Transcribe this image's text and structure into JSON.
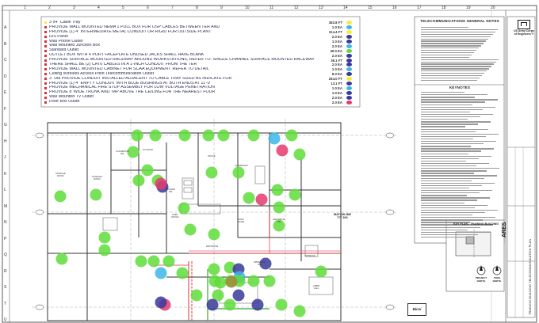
{
  "sheet": {
    "columns": [
      "1",
      "2",
      "3",
      "4",
      "5",
      "6",
      "7",
      "8",
      "9",
      "10",
      "11",
      "12",
      "13",
      "14",
      "15",
      "16",
      "17",
      "18",
      "19",
      "20"
    ],
    "rows": [
      "A",
      "B",
      "C",
      "D",
      "E",
      "F",
      "G",
      "H",
      "J",
      "K",
      "L",
      "M",
      "N",
      "P",
      "Q",
      "R",
      "S",
      "T",
      "U"
    ]
  },
  "legend": [
    {
      "text": "3\"x4\" Cable Tray",
      "qty": "382.8 FT",
      "swatch": "#f5ed3d",
      "marker": "#f5ed3d"
    },
    {
      "text": "PROVIDE WALL MOUNTED NEMA 1 PULL BOX FOR OSP CABLES BETWEEN TER AND",
      "qty": "1.0 EA",
      "swatch": "#3bb7e8",
      "marker": "#d33"
    },
    {
      "text": "PROVIDE (1) 4\" INTERMEDIATE METAL CONDUIT OR RIGID FOR OUTSIDE PLANT",
      "qty": "314.4 FT",
      "swatch": "#f5ed3d",
      "marker": "#d33"
    },
    {
      "text": "IDS Panel",
      "qty": "2.0 EA",
      "swatch": "#3a3a9a",
      "marker": "#d33"
    },
    {
      "text": "Wall Phone Outlet",
      "qty": "1.0 EA",
      "swatch": "#3a3a9a",
      "marker": "#d33"
    },
    {
      "text": "Wall Mounted Junction Box",
      "qty": "2.0 EA",
      "swatch": "#3bb7e8",
      "marker": "#d33"
    },
    {
      "text": "Standard Outlet",
      "qty": "49.0 EA",
      "swatch": "#5fdc3a",
      "marker": "#d33"
    },
    {
      "text": "OUTLET BOX WITH 4 PORT FACEPLATE UNUSED JACKS SHALL HAVE BLANK",
      "qty": "2.0 EA",
      "swatch": "#3a3a9a",
      "marker": "#d33"
    },
    {
      "text": "PROVIDE SURFACE MOUNTED RACEWAY AROUND WORKSTATIONS, REFER TO. SINGLE CHANNEL SURFACE MOUNTED RACEWAY",
      "qty": "36.1 FT",
      "swatch": "#3a3a9a",
      "marker": "#d33"
    },
    {
      "text": "THERE SHALL BE (2) CAT6 CABLES IN A 1-INCH CONDUIT FROM THE TER",
      "qty": "2.0 EA",
      "swatch": "#3a3a9a",
      "marker": "#d33"
    },
    {
      "text": "PROVIDE WALL MOUNTED CABINET FOR SCAA EQUIPMENT. REFER TO DETAIL",
      "qty": "1.0 EA",
      "swatch": "#3bb7e8",
      "marker": "#d33"
    },
    {
      "text": "Ceiling Wireless Access Point Telecommunication Outlet",
      "qty": "8.0 EA",
      "swatch": "#3a3a9a",
      "marker": "#d33"
    },
    {
      "text": "3\" Dia PROVIDE CONDUIT INSTALLED ADJACENT TO CABLE TRAY SIZED AS INDICATE FOR",
      "qty": "264.0 FT",
      "swatch": "#f5ed3d",
      "marker": "#d33"
    },
    {
      "text": "PROVIDE (1) 4\" EMPTY CONDUIT WITH BLUE BUSHINGS AT BOTH ENDS AT 11'-0\"",
      "qty": "13.1 FT",
      "swatch": "#3a3a9a",
      "marker": "#d33"
    },
    {
      "text": "PROVIDE MECHANICAL FIRE STOP ASSEMBLY FOR LOW VOLTAGE PENETRATION",
      "qty": "1.0 EA",
      "swatch": "#3bb7e8",
      "marker": "#d33"
    },
    {
      "text": "PROVIDE 8' WIDE TRUNK AND TAP ABOVE THE CEILING FOR THE NEAREST FOUR",
      "qty": "1.0 EA",
      "swatch": "#3a3a9a",
      "marker": "#d33"
    },
    {
      "text": "Wall Mounted TV Outlet",
      "qty": "2.0 EA",
      "swatch": "#3a3a9a",
      "marker": "#d33"
    },
    {
      "text": "Floor Box Outlet",
      "qty": "2.0 EA",
      "swatch": "#e53a6e",
      "marker": "#d33"
    }
  ],
  "notes": {
    "general_title": "TELECOMMUNICATIONS GENERAL NOTES",
    "keynotes_title": "KEYNOTES"
  },
  "title_block": {
    "org_line1": "US Army Corps",
    "org_line2": "of Engineers ®",
    "ares_logo": "ARES",
    "vertical_title": "TRAINING BUILDING TELECOMMUNICATION PLAN",
    "bicsi_logo": "Bicsi"
  },
  "plan": {
    "matchline_label": "MATCHLINE",
    "matchline_ref": "T/T 200",
    "keyplan_label": "KEY PLAN - TRAINING BUILDING",
    "north_project": "PROJECT NORTH",
    "north_true": "TRUE NORTH",
    "rooms": [
      {
        "label": "STORAGE\nROOM"
      },
      {
        "label": "STORAGE\nROOM"
      },
      {
        "label": "CLASSROOM\nRM"
      },
      {
        "label": "FIT ROOM"
      },
      {
        "label": "LOCKER\nRM"
      },
      {
        "label": "OFFICE"
      },
      {
        "label": "CLASSROOM"
      },
      {
        "label": "CONF\nROOM"
      },
      {
        "label": "OPEN\nOFFICE"
      },
      {
        "label": "RESTROOM"
      },
      {
        "label": "ELECTRICAL\nRM"
      },
      {
        "label": "SPRINKLER\nRM"
      },
      {
        "label": "STORAGE"
      },
      {
        "label": "LOBBY\nHALL"
      }
    ]
  }
}
